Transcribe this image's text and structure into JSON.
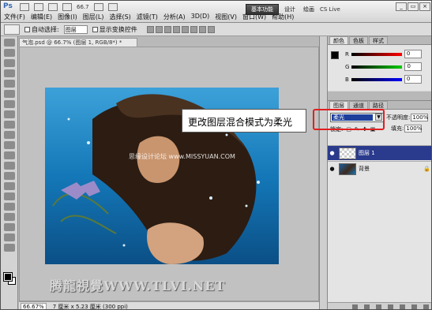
{
  "app": {
    "logo": "Ps",
    "zoom": "66.7",
    "title": "气泡.psd @ 66.7% (图层 1, RGB/8*) *"
  },
  "menu": [
    "文件(F)",
    "编辑(E)",
    "图像(I)",
    "图层(L)",
    "选择(S)",
    "滤镜(T)",
    "分析(A)",
    "3D(D)",
    "视图(V)",
    "窗口(W)",
    "帮助(H)"
  ],
  "workspace": {
    "essential": "基本功能",
    "design": "设计",
    "painting": "绘画",
    "cslive": "CS Live"
  },
  "window_controls": [
    "_",
    "▭",
    "×"
  ],
  "options_bar": {
    "auto_select_label": "自动选择:",
    "auto_select_value": "图层",
    "show_transform_label": "显示变换控件"
  },
  "status": {
    "zoom": "66.67%",
    "doc_info": "7 厘米 x 5.23 厘米 (300 ppi)"
  },
  "callout": "更改图层混合模式为柔光",
  "watermark": {
    "text": "腾龍視覺WWW.TLVI.NET",
    "site": "思缘设计论坛 www.MISSYUAN.COM"
  },
  "color_panel": {
    "tabs": [
      "颜色",
      "色板",
      "样式"
    ],
    "channels": [
      {
        "label": "R",
        "value": "0"
      },
      {
        "label": "G",
        "value": "0"
      },
      {
        "label": "B",
        "value": "0"
      }
    ]
  },
  "layers_panel": {
    "tabs": [
      "图层",
      "通道",
      "路径"
    ],
    "blend_mode": "柔光",
    "opacity_label": "不透明度:",
    "opacity_value": "100%",
    "lock_label": "锁定:",
    "fill_label": "填充:",
    "fill_value": "100%",
    "layers": [
      {
        "name": "图层 1",
        "selected": true
      },
      {
        "name": "背景",
        "selected": false
      }
    ]
  },
  "colors": {
    "selection": "#2a3a8c",
    "highlight": "#e02020",
    "blend_highlight": "#1c3f9c"
  }
}
